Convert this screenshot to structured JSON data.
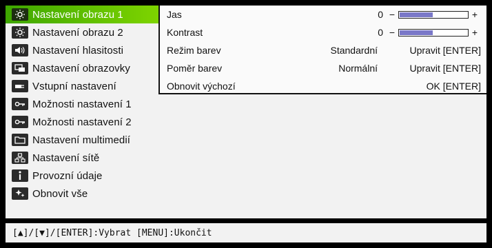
{
  "menu": {
    "items": [
      {
        "label": "Nastavení obrazu 1",
        "icon": "brightness-icon",
        "selected": true
      },
      {
        "label": "Nastavení obrazu 2",
        "icon": "brightness-icon",
        "selected": false
      },
      {
        "label": "Nastavení hlasitosti",
        "icon": "speaker-icon",
        "selected": false
      },
      {
        "label": "Nastavení obrazovky",
        "icon": "screen-icon",
        "selected": false
      },
      {
        "label": "Vstupní nastavení",
        "icon": "input-cable-icon",
        "selected": false
      },
      {
        "label": "Možnosti nastavení 1",
        "icon": "key-icon",
        "selected": false
      },
      {
        "label": "Možnosti nastavení 2",
        "icon": "key-icon",
        "selected": false
      },
      {
        "label": "Nastavení multimedií",
        "icon": "folder-icon",
        "selected": false
      },
      {
        "label": "Nastavení sítě",
        "icon": "network-icon",
        "selected": false
      },
      {
        "label": "Provozní údaje",
        "icon": "info-icon",
        "selected": false
      },
      {
        "label": "Obnovit vše",
        "icon": "sparkle-icon",
        "selected": false
      }
    ]
  },
  "submenu": {
    "jas": {
      "label": "Jas",
      "value": "0",
      "minus": "−",
      "plus": "+",
      "level": 0.5
    },
    "kontrast": {
      "label": "Kontrast",
      "value": "0",
      "minus": "−",
      "plus": "+",
      "level": 0.5
    },
    "rezim": {
      "label": "Režim barev",
      "value": "Standardní",
      "action": "Upravit [ENTER]"
    },
    "pomer": {
      "label": "Poměr barev",
      "value": "Normální",
      "action": "Upravit [ENTER]"
    },
    "obnovit": {
      "label": "Obnovit výchozí",
      "action": "OK [ENTER]"
    }
  },
  "footer": {
    "hint": "[▲]/[▼]/[ENTER]:Vybrat [MENU]:Ukončit"
  },
  "colors": {
    "selected_bg": "#51b000",
    "slider_fill": "#7a78c8"
  }
}
